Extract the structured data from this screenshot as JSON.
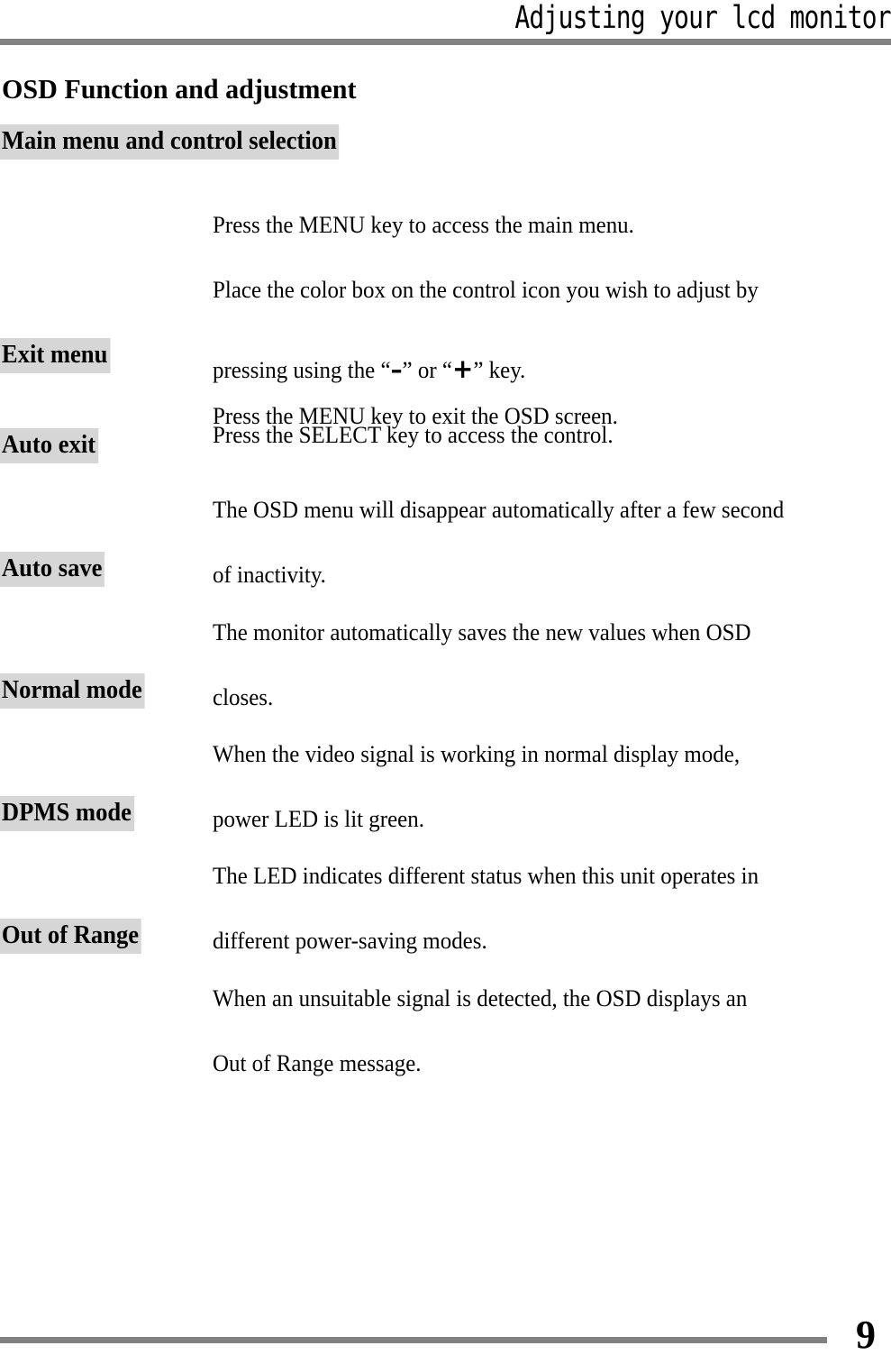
{
  "header": {
    "running_title": "Adjusting your lcd monitor",
    "rule_color": "#808080"
  },
  "doc": {
    "title": "OSD Function and adjustment",
    "highlight_color": "#d6d6d6"
  },
  "sections": [
    {
      "heading": "Main menu and control selection",
      "body_lines": [
        "Press the MENU key to access the main menu.",
        "Place the color box on the control icon you wish to adjust by"
      ],
      "body_lines_2": [
        "Press the SELECT key to access the control."
      ],
      "symbol_line": {
        "prefix": "pressing using the “",
        "minus": "–",
        "middle": "” or “",
        "plus": "+",
        "suffix": "” key."
      }
    },
    {
      "heading": "Exit menu",
      "body_lines": [
        "Press the MENU key to exit the OSD screen."
      ]
    },
    {
      "heading": "Auto exit",
      "body_lines": [
        "The OSD menu will disappear automatically after a few second",
        "of inactivity."
      ]
    },
    {
      "heading": "Auto save",
      "body_lines": [
        "The monitor automatically saves the new values when OSD",
        "closes."
      ]
    },
    {
      "heading": "Normal mode",
      "body_lines": [
        "When the video signal is working in normal display mode,",
        "power LED is lit green."
      ]
    },
    {
      "heading": "DPMS mode",
      "body_lines": [
        "The LED indicates different status when this unit operates in",
        "different power-saving modes."
      ]
    },
    {
      "heading": "Out of Range",
      "body_lines": [
        "When an unsuitable signal is detected, the OSD displays an",
        "Out of Range message."
      ]
    }
  ],
  "footer": {
    "page_number": "9",
    "rule_color": "#808080"
  }
}
